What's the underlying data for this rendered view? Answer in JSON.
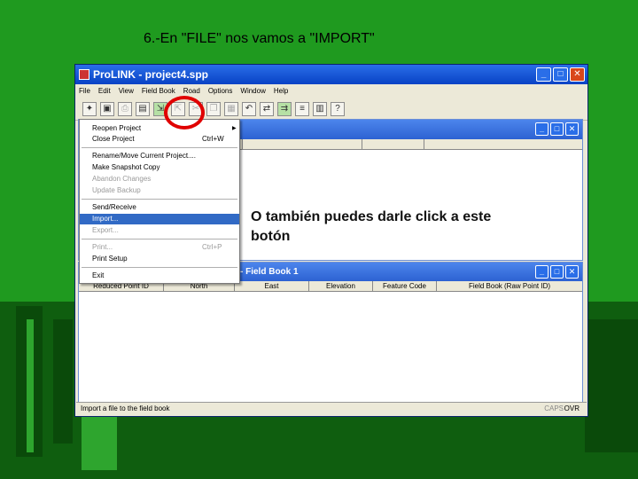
{
  "slide": {
    "title": "6.-En \"FILE\" nos vamos a \"IMPORT\""
  },
  "annotation": "O también puedes darle click a este botón",
  "window": {
    "title": "ProLINK - project4.spp"
  },
  "menubar": [
    "File",
    "Edit",
    "View",
    "Field Book",
    "Road",
    "Options",
    "Window",
    "Help"
  ],
  "file_menu": {
    "items": [
      {
        "label": "Reopen Project",
        "shortcut": "",
        "state": "submenu"
      },
      {
        "label": "Close Project",
        "shortcut": "Ctrl+W",
        "state": "enabled"
      },
      {
        "label": "Rename/Move Current Project....",
        "shortcut": "",
        "state": "enabled"
      },
      {
        "label": "Make Snapshot Copy",
        "shortcut": "",
        "state": "enabled"
      },
      {
        "label": "Abandon Changes",
        "shortcut": "",
        "state": "disabled"
      },
      {
        "label": "Update Backup",
        "shortcut": "",
        "state": "disabled"
      },
      {
        "label": "Send/Receive",
        "shortcut": "",
        "state": "enabled"
      },
      {
        "label": "Import...",
        "shortcut": "",
        "state": "selected"
      },
      {
        "label": "Export...",
        "shortcut": "",
        "state": "disabled"
      },
      {
        "label": "Print...",
        "shortcut": "Ctrl+P",
        "state": "disabled"
      },
      {
        "label": "Print Setup",
        "shortcut": "",
        "state": "enabled"
      },
      {
        "label": "Exit",
        "shortcut": "",
        "state": "enabled"
      }
    ]
  },
  "field_book": {
    "title": "- Field Book 1",
    "columns": [
      "Reduced Point ID",
      "North",
      "East",
      "Elevation",
      "Feature Code",
      "Field Book (Raw Point ID)"
    ]
  },
  "statusbar": {
    "text": "Import a file to the field book",
    "caps": "CAPS",
    "ovr": "OVR"
  },
  "icons": {
    "toolbar": [
      "new-project-icon",
      "open-project-icon",
      "print-icon",
      "field-book-icon",
      "import-icon",
      "export-icon",
      "cut-icon",
      "copy-icon",
      "paste-icon",
      "undo-icon",
      "send-receive-icon",
      "transfer-icon",
      "list-icon",
      "report-icon",
      "help-icon"
    ]
  },
  "colors": {
    "accent": "#316ac5",
    "highlight_circle": "#e00000",
    "background": "#1f9a1f"
  }
}
